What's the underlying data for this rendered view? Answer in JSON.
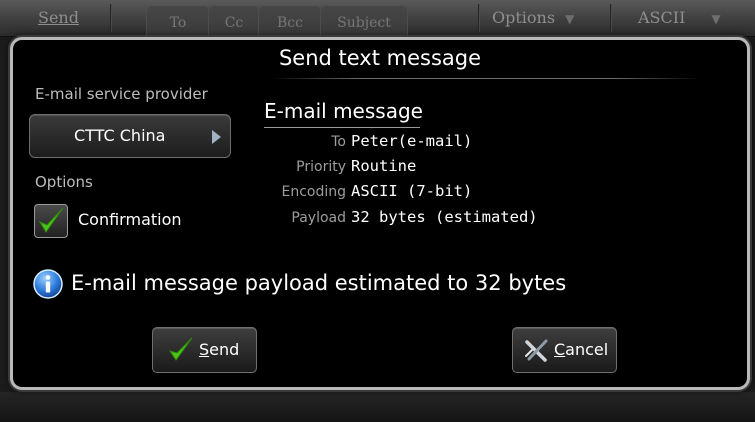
{
  "toolbar": {
    "send_label": "Send",
    "tab_to": "To",
    "tab_cc": "Cc",
    "tab_bcc": "Bcc",
    "tab_subject": "Subject",
    "options_label": "Options",
    "encoding_label": "ASCII"
  },
  "dialog": {
    "title": "Send text message",
    "provider_section_label": "E-mail service provider",
    "provider_value": "CTTC China",
    "options_section_label": "Options",
    "confirmation_label": "Confirmation",
    "confirmation_checked": true,
    "email_heading": "E-mail message",
    "details": [
      {
        "key": "To",
        "value": "Peter(e-mail)"
      },
      {
        "key": "Priority",
        "value": "Routine"
      },
      {
        "key": "Encoding",
        "value": "ASCII (7-bit)"
      },
      {
        "key": "Payload",
        "value": "32 bytes (estimated)"
      }
    ],
    "info_message": "E-mail message payload estimated to 32 bytes",
    "send_button": {
      "mnemonic": "S",
      "rest": "end"
    },
    "cancel_button": {
      "mnemonic": "C",
      "rest": "ancel"
    }
  },
  "icons": {
    "info": "info-icon",
    "check": "checkmark-icon",
    "cancel": "cross-icon",
    "arrow": "chevron-right-icon"
  },
  "colors": {
    "dialog_bg": "#000000",
    "dialog_border": "#b9b9b9",
    "check_green": "#4cc417",
    "info_blue": "#2f7fe0"
  }
}
